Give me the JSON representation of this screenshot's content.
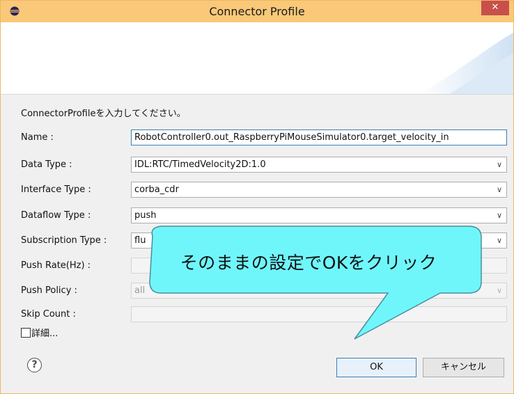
{
  "window": {
    "title": "Connector Profile",
    "close_glyph": "✕"
  },
  "dialog": {
    "description": "ConnectorProfileを入力してください。"
  },
  "form": {
    "name": {
      "label": "Name :",
      "value": "RobotController0.out_RaspberryPiMouseSimulator0.target_velocity_in"
    },
    "data_type": {
      "label": "Data Type :",
      "value": "IDL:RTC/TimedVelocity2D:1.0"
    },
    "interface_type": {
      "label": "Interface Type :",
      "value": "corba_cdr"
    },
    "dataflow_type": {
      "label": "Dataflow Type :",
      "value": "push"
    },
    "subscription_type": {
      "label": "Subscription Type :",
      "value": "flu"
    },
    "push_rate": {
      "label": "Push Rate(Hz) :",
      "value": ""
    },
    "push_policy": {
      "label": "Push Policy :",
      "value": "all"
    },
    "skip_count": {
      "label": "Skip Count :",
      "value": ""
    }
  },
  "details": {
    "label": "詳細..."
  },
  "help_glyph": "?",
  "buttons": {
    "ok": "OK",
    "cancel": "キャンセル"
  },
  "callout": {
    "text": "そのままの設定でOKをクリック",
    "color": "#6ff6fb"
  },
  "icons": {
    "app": "eclipse-icon",
    "close": "close-icon",
    "help": "help-icon",
    "dropdown": "chevron-down-icon"
  },
  "colors": {
    "titlebar": "#f9c878",
    "close": "#c7504b",
    "accent": "#3c7fb1"
  }
}
